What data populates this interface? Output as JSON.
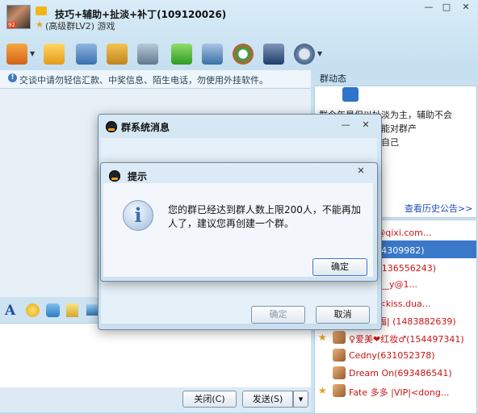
{
  "group": {
    "name": "技巧+辅助+扯淡+补丁(109120026)",
    "subtitle": "(高级群LV2) 游戏",
    "avatar_badge": "92"
  },
  "window_controls": {
    "minimize": "—",
    "maximize": "□",
    "close": "✕"
  },
  "toolbar": {
    "icons": [
      "home-icon",
      "folder-icon",
      "film-icon",
      "photo-icon",
      "album-icon",
      "plus-app-icon",
      "tools-icon",
      "qq-s-icon",
      "officer-icon",
      "gear-icon"
    ]
  },
  "notice": {
    "text": "交谈中请勿轻信汇款、中奖信息、陌生电话，勿使用外挂软件。"
  },
  "input_toolbar": {
    "font": "A"
  },
  "buttons": {
    "close": "关闭(C)",
    "send": "发送(S)",
    "send_dropdown": "▾"
  },
  "group_dynamics": {
    "title": "群动态",
    "announcement_lines": [
      "群今年是但以扯淡为主，辅助不会",
      "一一一一，大家能对群产",
      "成一个能够释放自己"
    ],
    "history_link": "查看历史公告>>"
  },
  "members": [
    {
      "star": false,
      "name": "星星<i@qixi.com...",
      "color": "#c81414"
    },
    {
      "star": false,
      "name": "番茄(154309982)",
      "color": "#ffffff",
      "selected": true
    },
    {
      "star": false,
      "name": "那年、  (136556243)",
      "color": "#c81414"
    },
    {
      "star": false,
      "name": "s__o__r__y@1...",
      "color": "#c81414"
    },
    {
      "star": false,
      "name": "那曾经 <kiss.dua...",
      "color": "#c81414"
    },
    {
      "star": true,
      "name": "|◇↖ 弥福| (1483882639)",
      "color": "#c81414"
    },
    {
      "star": true,
      "name": "♀爱美❤红妆♂(154497341)",
      "color": "#c81414"
    },
    {
      "star": false,
      "name": "Cedny(631052378)",
      "color": "#c81414"
    },
    {
      "star": false,
      "name": "Dream On(693486541)",
      "color": "#c81414"
    },
    {
      "star": true,
      "name": "Fate    多多 |VIP|<dong...",
      "color": "#c81414"
    }
  ],
  "sys_dialog": {
    "title": "群系统消息",
    "ok": "确定",
    "cancel": "取消"
  },
  "tip_dialog": {
    "title": "提示",
    "message": "您的群已经达到群人数上限200人，不能再加人了，建议您再创建一个群。",
    "ok": "确定",
    "icon": "info-icon"
  },
  "colors": {
    "accent": "#2f74c8",
    "member_text": "#c81414",
    "selected_row": "#3a78c9"
  }
}
